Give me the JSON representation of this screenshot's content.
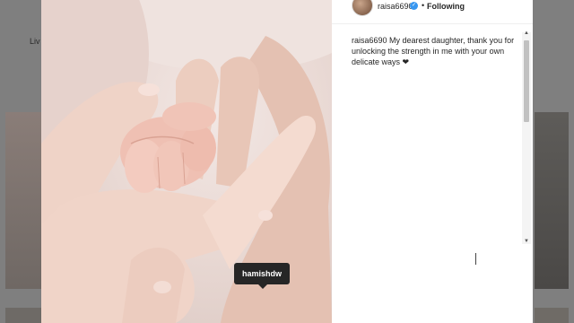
{
  "background_page": {
    "story_label": "Liv",
    "nav_icons": [
      "close-icon",
      "next-arrow-icon",
      "prev-arrow-icon"
    ]
  },
  "post": {
    "username": "raisa6690",
    "verified": true,
    "separator": "•",
    "follow_status": "Following",
    "caption_user": "raisa6690",
    "caption_text": "My dearest daughter, thank you for unlocking the strength in me with your own delicate ways ❤",
    "photo_tag": "hamishdw"
  },
  "colors": {
    "verified_badge": "#3897f0",
    "tag_bubble": "#262626",
    "overlay": "#7f7f7f"
  }
}
